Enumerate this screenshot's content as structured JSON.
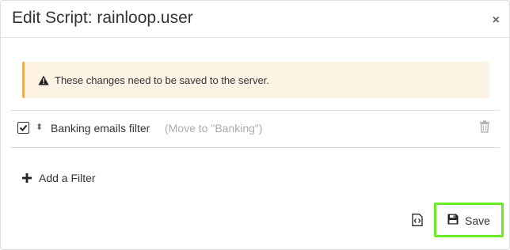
{
  "dialog": {
    "title": "Edit Script: rainloop.user",
    "close_glyph": "×"
  },
  "alert": {
    "message": "These changes need to be saved to the server.",
    "icon": "warning-icon",
    "accent_color": "#f0ad4e",
    "background_color": "#fcf3e4"
  },
  "filters": [
    {
      "enabled": true,
      "drag_glyph": "⬍",
      "name": "Banking emails filter",
      "description": "(Move to \"Banking\")"
    }
  ],
  "actions": {
    "add_filter_label": "Add a Filter",
    "save_label": "Save",
    "save_highlight_color": "#66ee22"
  }
}
